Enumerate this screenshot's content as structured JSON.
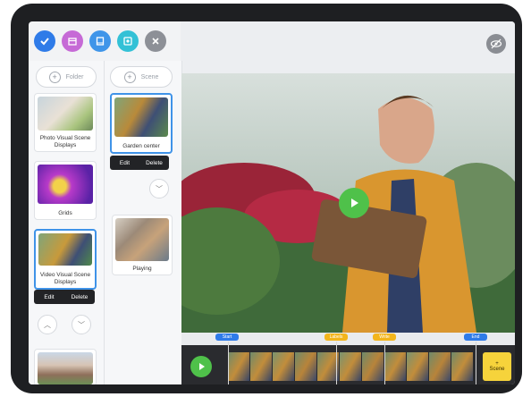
{
  "toolbar": {
    "icons": [
      "check-icon",
      "calendar-icon",
      "book-icon",
      "gallery-icon",
      "close-icon"
    ],
    "colors": [
      "#2f7be8",
      "#c66ad6",
      "#3f95e9",
      "#33c1d6",
      "#8d9097"
    ]
  },
  "top_right": {
    "icon": "eye-off-icon"
  },
  "folders": {
    "add_label": "Folder",
    "items": [
      {
        "label": "Photo Visual Scene Displays"
      },
      {
        "label": "Grids"
      },
      {
        "label": "Video Visual Scene Displays"
      }
    ],
    "edit_label": "Edit",
    "delete_label": "Delete"
  },
  "scenes": {
    "add_label": "Scene",
    "items": [
      {
        "label": "Garden center"
      },
      {
        "label": "Playing"
      }
    ],
    "edit_label": "Edit",
    "delete_label": "Delete"
  },
  "timeline": {
    "markers": [
      {
        "label": "Start",
        "color": "#2f7be8"
      },
      {
        "label": "Labels",
        "color": "#f3b51b"
      },
      {
        "label": "Write",
        "color": "#f3b51b"
      },
      {
        "label": "End",
        "color": "#2f7be8"
      }
    ],
    "scene_button": {
      "symbol": "+",
      "label": "Scene"
    }
  }
}
